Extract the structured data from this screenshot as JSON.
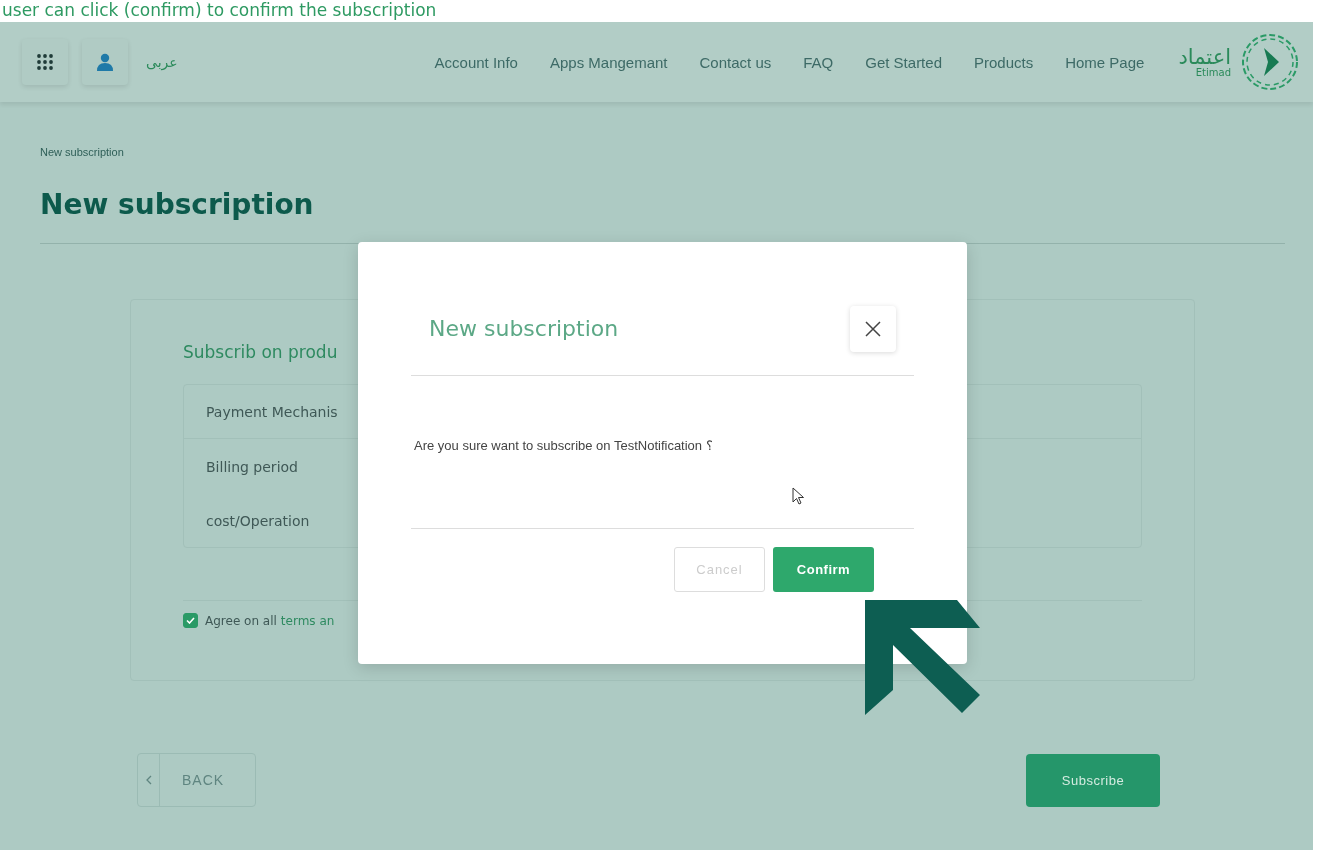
{
  "caption": "user can click (confirm) to confirm the subscription",
  "header": {
    "language": "عربى",
    "nav": [
      "Account Info",
      "Apps Mangemant",
      "Contact us",
      "FAQ",
      "Get Started",
      "Products",
      "Home Page"
    ],
    "logo": {
      "arabic": "اعتماد",
      "latin": "Etimad"
    }
  },
  "breadcrumb": "New subscription",
  "title": "New subscription",
  "card": {
    "heading": "Subscrib on produ",
    "rows": [
      "Payment Mechanis",
      "Billing period",
      "cost/Operation"
    ],
    "agree": {
      "checked": true,
      "label": "Agree on all",
      "link": "terms an"
    }
  },
  "back_button": "BACK",
  "subscribe_button": "Subscribe",
  "modal": {
    "title": "New subscription",
    "message": "Are you sure want to subscribe on TestNotification ؟",
    "cancel": "Cancel",
    "confirm": "Confirm"
  }
}
